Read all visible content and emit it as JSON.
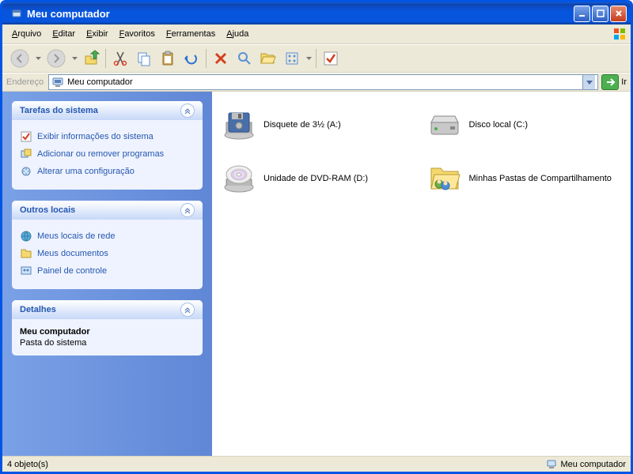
{
  "window": {
    "title": "Meu computador"
  },
  "menu": {
    "items": [
      "Arquivo",
      "Editar",
      "Exibir",
      "Favoritos",
      "Ferramentas",
      "Ajuda"
    ]
  },
  "address": {
    "label": "Endereço",
    "value": "Meu computador",
    "go": "Ir"
  },
  "sidebar": {
    "panels": [
      {
        "title": "Tarefas do sistema",
        "links": [
          {
            "label": "Exibir informações do sistema"
          },
          {
            "label": "Adicionar ou remover programas"
          },
          {
            "label": "Alterar uma configuração"
          }
        ]
      },
      {
        "title": "Outros locais",
        "links": [
          {
            "label": "Meus locais de rede"
          },
          {
            "label": "Meus documentos"
          },
          {
            "label": "Painel de controle"
          }
        ]
      },
      {
        "title": "Detalhes",
        "details": {
          "name": "Meu computador",
          "type": "Pasta do sistema"
        }
      }
    ]
  },
  "drives": [
    {
      "label": "Disquete de 3½ (A:)",
      "kind": "floppy"
    },
    {
      "label": "Disco local (C:)",
      "kind": "hdd"
    },
    {
      "label": "Unidade de DVD-RAM (D:)",
      "kind": "dvd"
    },
    {
      "label": "Minhas Pastas de Compartilhamento",
      "kind": "shared"
    }
  ],
  "status": {
    "left": "4 objeto(s)",
    "right": "Meu computador"
  }
}
